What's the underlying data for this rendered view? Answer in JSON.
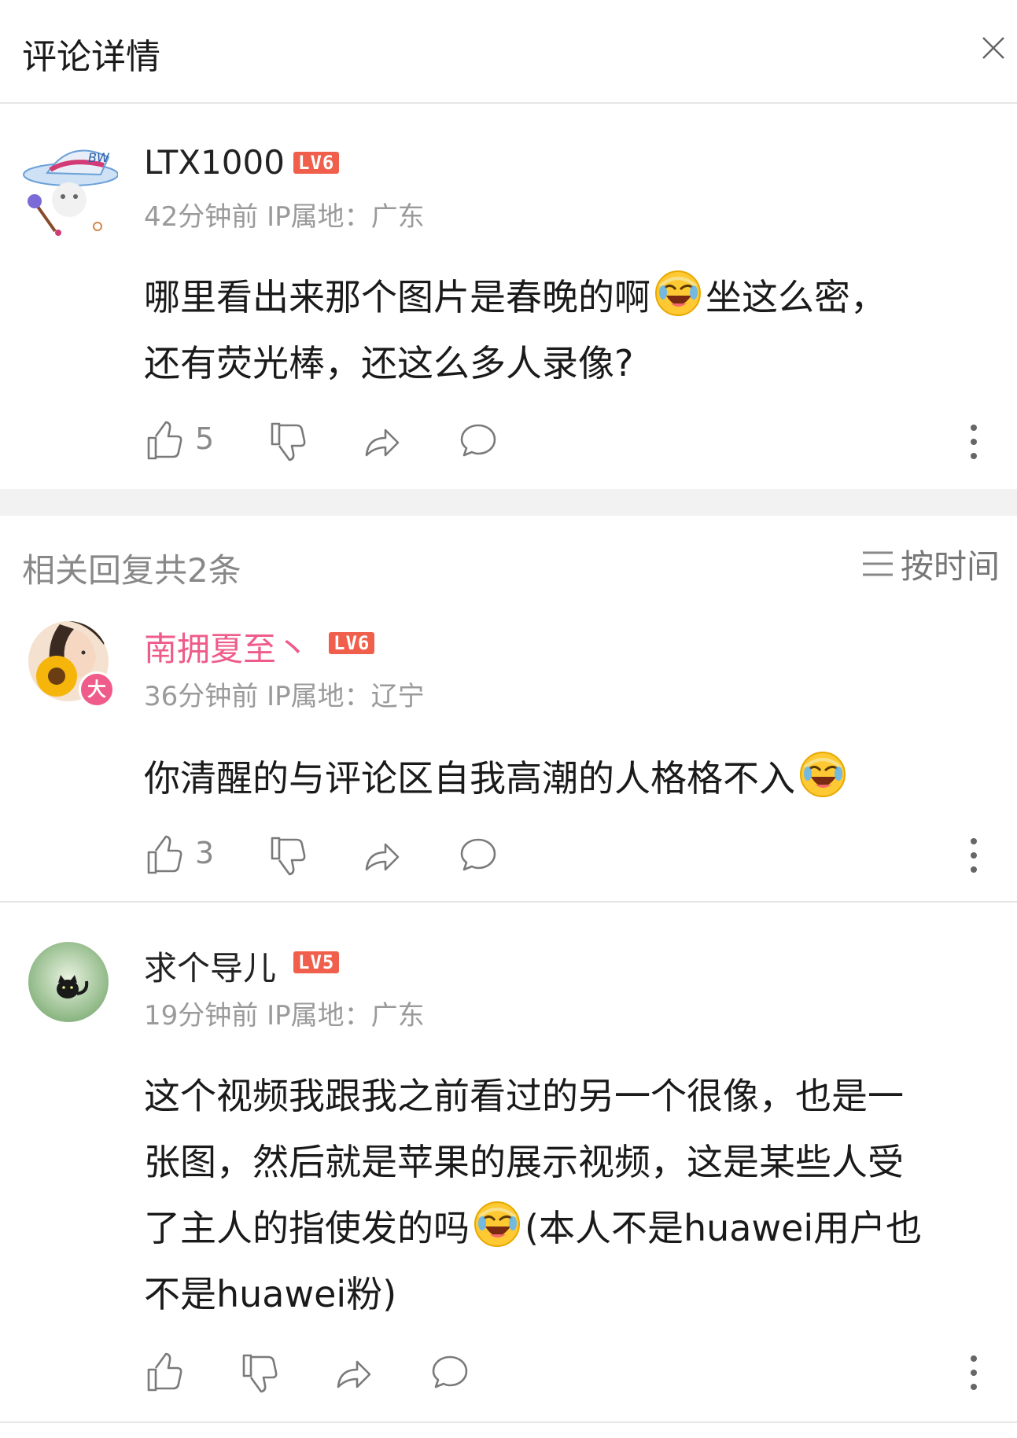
{
  "header": {
    "title": "评论详情"
  },
  "main_comment": {
    "username": "LTX1000",
    "level": "LV6",
    "meta": "42分钟前 IP属地：广东",
    "text_line1a": "哪里看出来那个图片是春晚的啊",
    "text_line1b": "坐这么密，",
    "text_line2": "还有荧光棒，还这么多人录像?",
    "likes": "5"
  },
  "replies_header": {
    "title": "相关回复共2条",
    "sort_label": "按时间"
  },
  "reply1": {
    "username": "南拥夏至丶",
    "level": "LV6",
    "avatar_badge": "大",
    "meta": "36分钟前 IP属地：辽宁",
    "text": "你清醒的与评论区自我高潮的人格格不入",
    "likes": "3"
  },
  "reply2": {
    "username": "求个导儿",
    "level": "LV5",
    "meta": "19分钟前 IP属地：广东",
    "text_line1": "这个视频我跟我之前看过的另一个很像，也是一",
    "text_line2": "张图，然后就是苹果的展示视频，这是某些人受",
    "text_line3a": "了主人的指使发的吗",
    "text_line3b": "(本人不是huawei用户也",
    "text_line4": "不是huawei粉)"
  },
  "colors": {
    "accent_pink": "#ef5b8a",
    "level_badge": "#f05f4c",
    "meta_gray": "#9a9a9a"
  },
  "icons": [
    "close-icon",
    "like-icon",
    "dislike-icon",
    "share-icon",
    "comment-icon",
    "more-icon",
    "sort-icon",
    "emoji-laugh-cry-icon"
  ]
}
